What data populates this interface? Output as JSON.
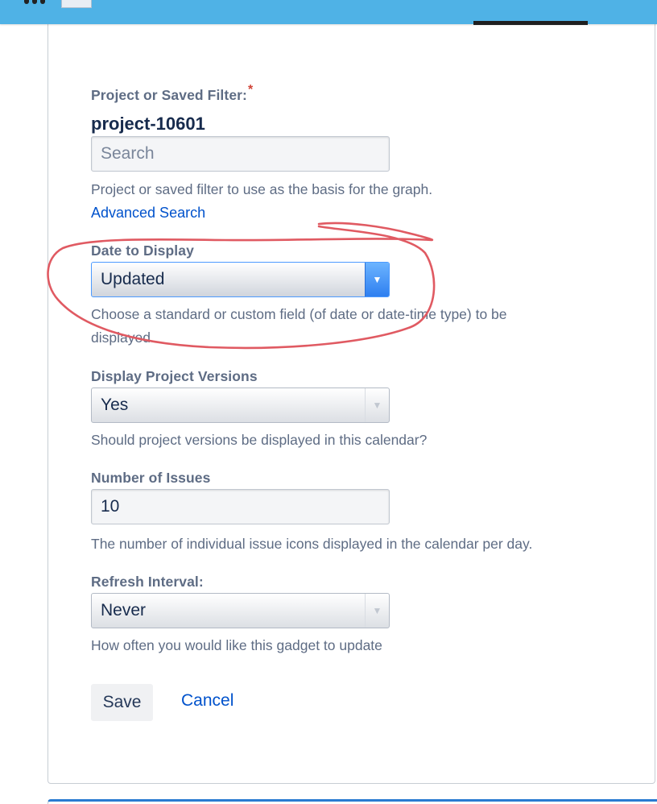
{
  "form": {
    "project_filter": {
      "label": "Project or Saved Filter:",
      "required_mark": "*",
      "selected_value": "project-10601",
      "search_placeholder": "Search",
      "help": "Project or saved filter to use as the basis for the graph.",
      "advanced_link": "Advanced Search"
    },
    "date_to_display": {
      "label": "Date to Display",
      "value": "Updated",
      "help": "Choose a standard or custom field (of date or date-time type) to be displayed."
    },
    "display_project_versions": {
      "label": "Display Project Versions",
      "value": "Yes",
      "help": "Should project versions be displayed in this calendar?"
    },
    "number_of_issues": {
      "label": "Number of Issues",
      "value": "10",
      "help": "The number of individual issue icons displayed in the calendar per day."
    },
    "refresh_interval": {
      "label": "Refresh Interval:",
      "value": "Never",
      "help": "How often you would like this gadget to update"
    },
    "save_label": "Save",
    "cancel_label": "Cancel"
  },
  "icons": {
    "dropdown": "chevron-down-icon"
  },
  "colors": {
    "header_bar": "#4fb2e6",
    "label_text": "#5e6c84",
    "link": "#0052cc",
    "required": "#d04437",
    "annotation": "#e05a62"
  }
}
